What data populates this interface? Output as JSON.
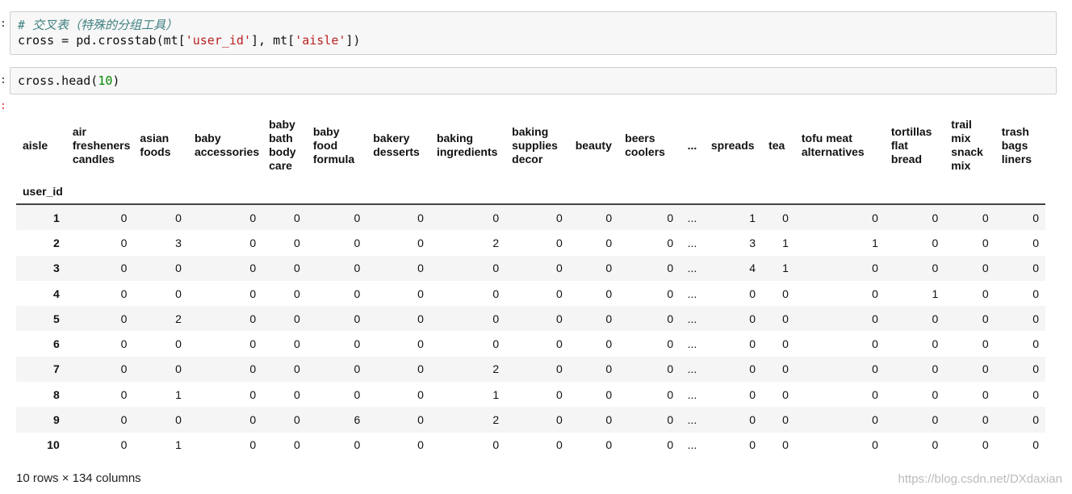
{
  "cell1": {
    "comment": "# 交叉表（特殊的分组工具）",
    "code_prefix": "cross = pd.crosstab(mt[",
    "arg1": "'user_id'",
    "code_mid": "], mt[",
    "arg2": "'aisle'",
    "code_suffix": "])"
  },
  "cell2": {
    "code_prefix": "cross.head(",
    "arg": "10",
    "code_suffix": ")"
  },
  "table": {
    "columns_label": "aisle",
    "index_label": "user_id",
    "columns": [
      "air fresheners candles",
      "asian foods",
      "baby accessories",
      "baby bath body care",
      "baby food formula",
      "bakery desserts",
      "baking ingredients",
      "baking supplies decor",
      "beauty",
      "beers coolers",
      "...",
      "spreads",
      "tea",
      "tofu meat alternatives",
      "tortillas flat bread",
      "trail mix snack mix",
      "trash bags liners"
    ],
    "rows": [
      {
        "id": "1",
        "values": [
          "0",
          "0",
          "0",
          "0",
          "0",
          "0",
          "0",
          "0",
          "0",
          "0",
          "...",
          "1",
          "0",
          "0",
          "0",
          "0",
          "0"
        ]
      },
      {
        "id": "2",
        "values": [
          "0",
          "3",
          "0",
          "0",
          "0",
          "0",
          "2",
          "0",
          "0",
          "0",
          "...",
          "3",
          "1",
          "1",
          "0",
          "0",
          "0"
        ]
      },
      {
        "id": "3",
        "values": [
          "0",
          "0",
          "0",
          "0",
          "0",
          "0",
          "0",
          "0",
          "0",
          "0",
          "...",
          "4",
          "1",
          "0",
          "0",
          "0",
          "0"
        ]
      },
      {
        "id": "4",
        "values": [
          "0",
          "0",
          "0",
          "0",
          "0",
          "0",
          "0",
          "0",
          "0",
          "0",
          "...",
          "0",
          "0",
          "0",
          "1",
          "0",
          "0"
        ]
      },
      {
        "id": "5",
        "values": [
          "0",
          "2",
          "0",
          "0",
          "0",
          "0",
          "0",
          "0",
          "0",
          "0",
          "...",
          "0",
          "0",
          "0",
          "0",
          "0",
          "0"
        ]
      },
      {
        "id": "6",
        "values": [
          "0",
          "0",
          "0",
          "0",
          "0",
          "0",
          "0",
          "0",
          "0",
          "0",
          "...",
          "0",
          "0",
          "0",
          "0",
          "0",
          "0"
        ]
      },
      {
        "id": "7",
        "values": [
          "0",
          "0",
          "0",
          "0",
          "0",
          "0",
          "2",
          "0",
          "0",
          "0",
          "...",
          "0",
          "0",
          "0",
          "0",
          "0",
          "0"
        ]
      },
      {
        "id": "8",
        "values": [
          "0",
          "1",
          "0",
          "0",
          "0",
          "0",
          "1",
          "0",
          "0",
          "0",
          "...",
          "0",
          "0",
          "0",
          "0",
          "0",
          "0"
        ]
      },
      {
        "id": "9",
        "values": [
          "0",
          "0",
          "0",
          "0",
          "6",
          "0",
          "2",
          "0",
          "0",
          "0",
          "...",
          "0",
          "0",
          "0",
          "0",
          "0",
          "0"
        ]
      },
      {
        "id": "10",
        "values": [
          "0",
          "1",
          "0",
          "0",
          "0",
          "0",
          "0",
          "0",
          "0",
          "0",
          "...",
          "0",
          "0",
          "0",
          "0",
          "0",
          "0"
        ]
      }
    ]
  },
  "summary": "10 rows × 134 columns",
  "watermark": "https://blog.csdn.net/DXdaxian"
}
